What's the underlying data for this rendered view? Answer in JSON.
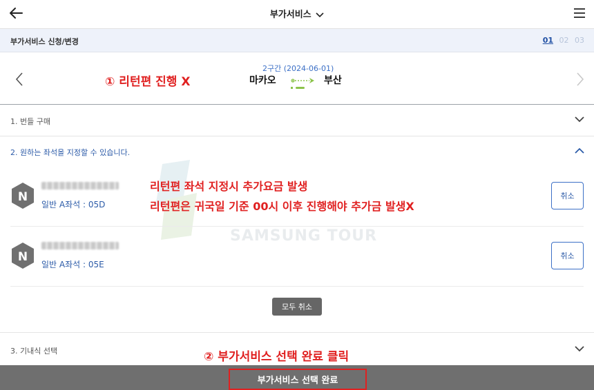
{
  "header": {
    "title": "부가서비스",
    "back_icon": "back-arrow-icon",
    "menu_icon": "hamburger-menu-icon"
  },
  "subheader": {
    "label": "부가서비스 신청/변경",
    "steps": [
      "01",
      "02",
      "03"
    ],
    "active_step": "01"
  },
  "segment": {
    "subtitle": "2구간 (2024-06-01)",
    "from": "마카오",
    "to": "부산"
  },
  "annotations": {
    "note1": "① 리턴편 진행 X",
    "note2_line1": "리턴편 좌석 지정시 추가요금 발생",
    "note2_line2": "리턴편은 귀국일 기준 00시 이후 진행해야 추가금 발생X",
    "note3": "② 부가서비스 선택 완료 클릭"
  },
  "sections": [
    {
      "title": "1. 번들 구매",
      "expanded": false
    },
    {
      "title": "2. 원하는 좌석을 지정할 수 있습니다.",
      "expanded": true
    },
    {
      "title": "3. 기내식 선택",
      "expanded": false
    }
  ],
  "watermark": {
    "text": "SAMSUNG TOUR"
  },
  "passengers": [
    {
      "avatar_letter": "N",
      "seat": "일반 A좌석 : 05D",
      "cancel_label": "취소"
    },
    {
      "avatar_letter": "N",
      "seat": "일반 A좌석 : 05E",
      "cancel_label": "취소"
    }
  ],
  "cancel_all_label": "모두 취소",
  "footer": {
    "complete_label": "부가서비스 선택 완료"
  },
  "colors": {
    "accent_blue": "#2c5ba8",
    "annotation_red": "#e02020",
    "footer_gray": "#6f6f6f",
    "subheader_bg": "#eef2fa"
  }
}
